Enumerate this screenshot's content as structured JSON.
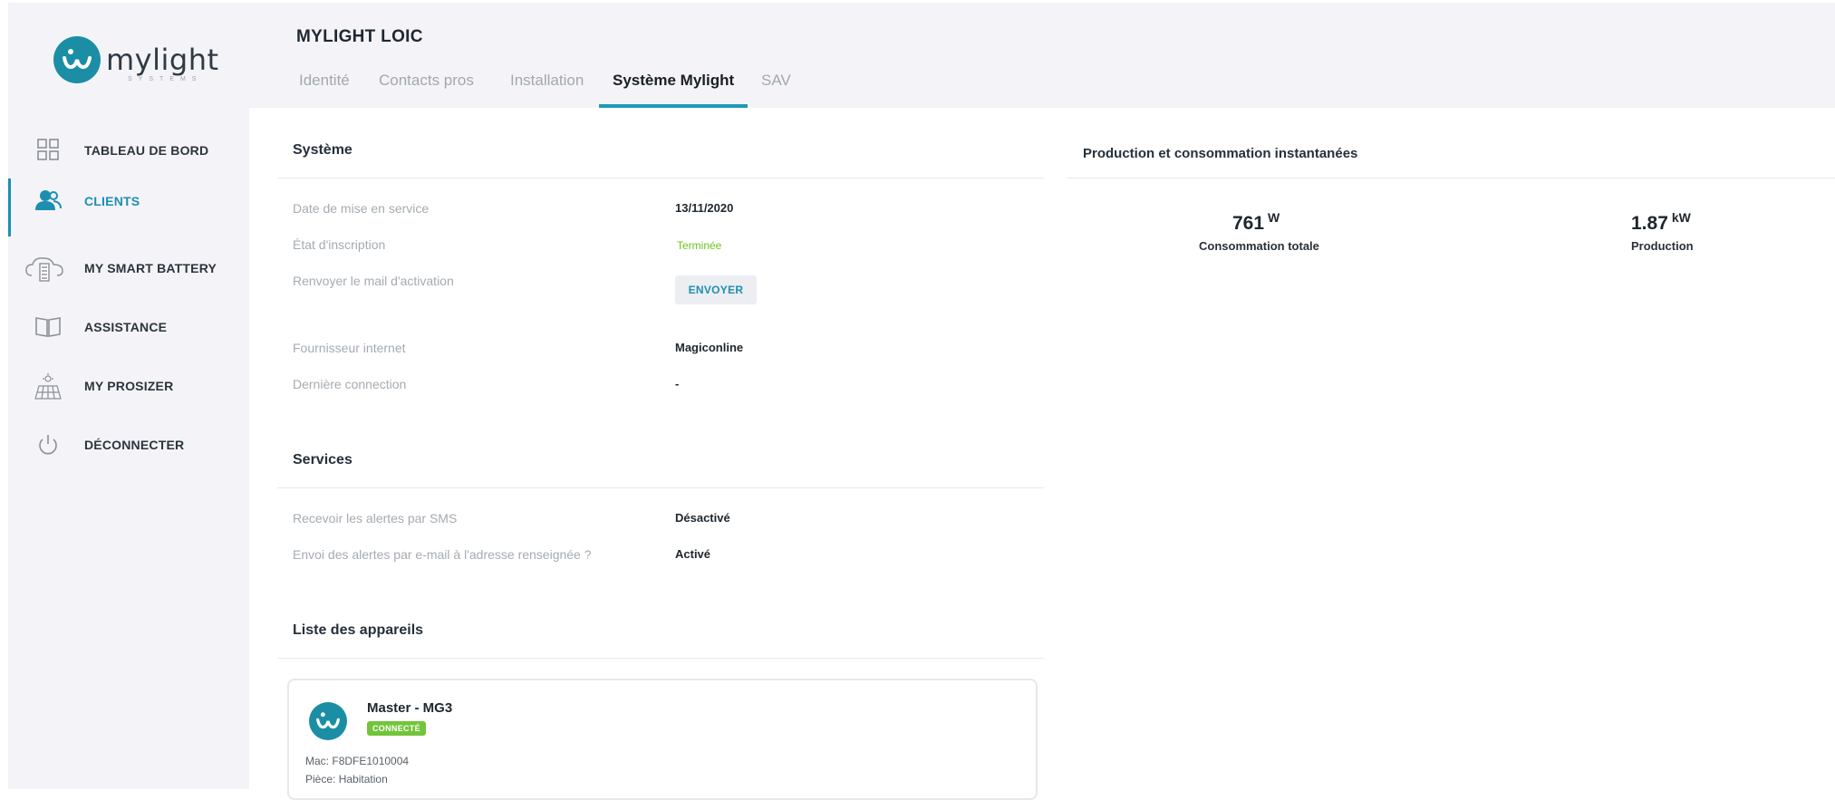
{
  "brand": {
    "name": "mylight",
    "subtitle": "SYSTEMS"
  },
  "sidebar": {
    "items": [
      {
        "label": "TABLEAU DE BORD",
        "icon": "grid-icon"
      },
      {
        "label": "CLIENTS",
        "icon": "users-icon",
        "active": true
      },
      {
        "label": "MY SMART BATTERY",
        "icon": "cloud-battery-icon"
      },
      {
        "label": "ASSISTANCE",
        "icon": "book-icon"
      },
      {
        "label": "MY PROSIZER",
        "icon": "solar-panel-icon"
      },
      {
        "label": "DÉCONNECTER",
        "icon": "power-icon"
      }
    ]
  },
  "header": {
    "client_name": "MYLIGHT LOIC",
    "tabs": [
      {
        "label": "Identité"
      },
      {
        "label": "Contacts pros"
      },
      {
        "label": "Installation"
      },
      {
        "label": "Système Mylight",
        "active": true
      },
      {
        "label": "SAV"
      }
    ]
  },
  "systeme": {
    "title": "Système",
    "fields": [
      {
        "label": "Date de mise en service",
        "value": "13/11/2020"
      },
      {
        "label": "État d'inscription",
        "value": "Terminée"
      },
      {
        "label": "Renvoyer le mail d'activation",
        "button": "ENVOYER"
      },
      {
        "label": "Fournisseur internet",
        "value": "Magiconline"
      },
      {
        "label": "Dernière connection",
        "value": "-"
      }
    ]
  },
  "services": {
    "title": "Services",
    "fields": [
      {
        "label": "Recevoir les alertes par SMS",
        "value": "Désactivé"
      },
      {
        "label": "Envoi des alertes par e-mail à l'adresse renseignée ?",
        "value": "Activé"
      }
    ]
  },
  "devices": {
    "title": "Liste des appareils",
    "items": [
      {
        "name": "Master - MG3",
        "status": "CONNECTÉ",
        "mac_label": "Mac:",
        "mac": "F8DFE1010004",
        "room_label": "Pièce:",
        "room": "Habitation"
      }
    ]
  },
  "production": {
    "title": "Production et consommation instantanées",
    "metrics": [
      {
        "value": "761",
        "unit": "W",
        "label": "Consommation totale"
      },
      {
        "value": "1.87",
        "unit": "kW",
        "label": "Production"
      }
    ]
  },
  "colors": {
    "accent": "#1c8fb0",
    "brand": "#1b8ea6",
    "success": "#6cc31d",
    "badge": "#72c53a"
  }
}
